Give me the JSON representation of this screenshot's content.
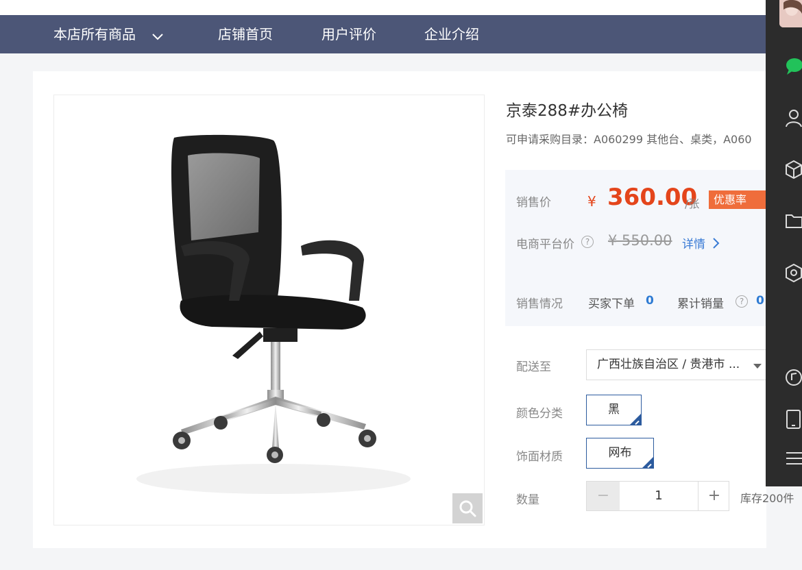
{
  "nav": {
    "all_products": "本店所有商品",
    "shop_home": "店铺首页",
    "user_reviews": "用户评价",
    "company_intro": "企业介绍"
  },
  "product": {
    "title": "京泰288#办公椅",
    "catalog": "可申请采购目录：A060299 其他台、桌类，A060",
    "image_alt": "黑色网布办公椅"
  },
  "pricing": {
    "sale_label": "销售价",
    "currency": "¥",
    "price": "360.00",
    "unit": "/张",
    "discount_label": "优惠率",
    "ecommerce_label": "电商平台价",
    "ecommerce_price": "¥ 550.00",
    "detail_link": "详情"
  },
  "sales": {
    "label": "销售情况",
    "buyer_orders_label": "买家下单",
    "buyer_orders": "0",
    "total_sales_label": "累计销量",
    "total_sales": "0"
  },
  "options": {
    "ship_label": "配送至",
    "ship_value": "广西壮族自治区 / 贵港市 ...",
    "color_label": "颜色分类",
    "color_value": "黑",
    "material_label": "饰面材质",
    "material_value": "网布",
    "qty_label": "数量",
    "qty_value": "1",
    "qty_minus": "−",
    "qty_plus": "+",
    "stock": "库存200件"
  },
  "colors": {
    "nav_bg": "#4c5677",
    "price_red": "#e4451b",
    "discount_orange": "#ef6d3b",
    "link_blue": "#3a7bd5",
    "selected_border": "#2c5b9e",
    "side_toolbar": "#2c2c2c"
  },
  "icons": {
    "nav_dropdown": "chevron-down-icon",
    "zoom": "magnifier-icon",
    "help": "question-circle-icon",
    "detail": "chevron-right-icon",
    "select": "caret-down-icon",
    "side": [
      "chat-icon",
      "user-icon",
      "cube-icon",
      "folder-icon",
      "hexagon-icon",
      "music-icon",
      "tablet-icon",
      "menu-icon"
    ]
  }
}
